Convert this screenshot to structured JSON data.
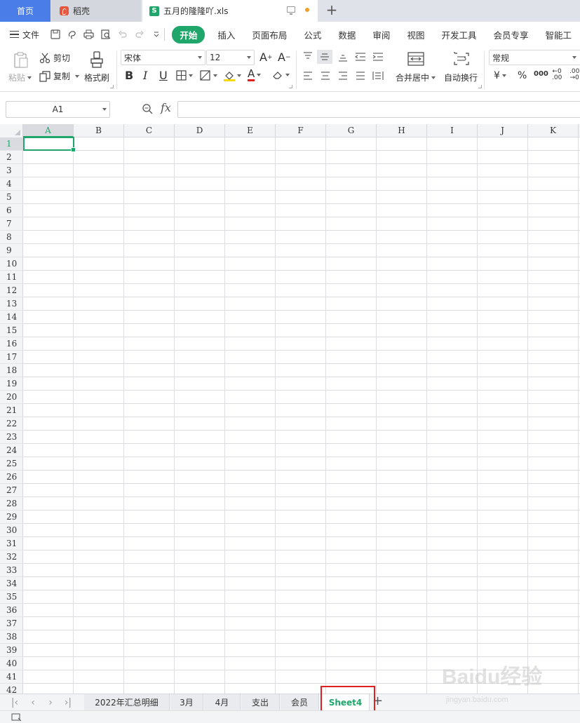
{
  "window_tabs": {
    "home": "首页",
    "daoke": "稻壳",
    "document": "五月的隆隆吖.xls"
  },
  "menu": {
    "file": "文件",
    "items": [
      "开始",
      "插入",
      "页面布局",
      "公式",
      "数据",
      "审阅",
      "视图",
      "开发工具",
      "会员专享",
      "智能工"
    ]
  },
  "ribbon": {
    "paste": "粘贴",
    "cut": "剪切",
    "copy": "复制",
    "format_painter": "格式刷",
    "font_name": "宋体",
    "font_size": "12",
    "merge_center": "合并居中",
    "wrap_text": "自动换行",
    "number_format": "常规",
    "currency": "¥",
    "percent": "%",
    "thousands": "000"
  },
  "formula_bar": {
    "name_box": "A1",
    "fx": "fx",
    "formula": ""
  },
  "columns": [
    "A",
    "B",
    "C",
    "D",
    "E",
    "F",
    "G",
    "H",
    "I",
    "J",
    "K"
  ],
  "rows": [
    "1",
    "2",
    "3",
    "4",
    "5",
    "6",
    "7",
    "8",
    "9",
    "10",
    "11",
    "12",
    "13",
    "14",
    "15",
    "16",
    "17",
    "18",
    "19",
    "20",
    "21",
    "22",
    "23",
    "24",
    "25",
    "26",
    "27",
    "28",
    "29",
    "30",
    "31",
    "32",
    "33",
    "34",
    "35",
    "36",
    "37",
    "38",
    "39",
    "40",
    "41",
    "42"
  ],
  "sheet_tabs": [
    "2022年汇总明细",
    "3月",
    "4月",
    "支出",
    "会员",
    "Sheet4"
  ],
  "active_sheet": "Sheet4",
  "colors": {
    "accent": "#1fa66b",
    "home_tab": "#4a7de8",
    "highlight": "#e02020"
  },
  "watermark": {
    "text": "Baidu经验",
    "sub": "jingyan.baidu.com"
  }
}
